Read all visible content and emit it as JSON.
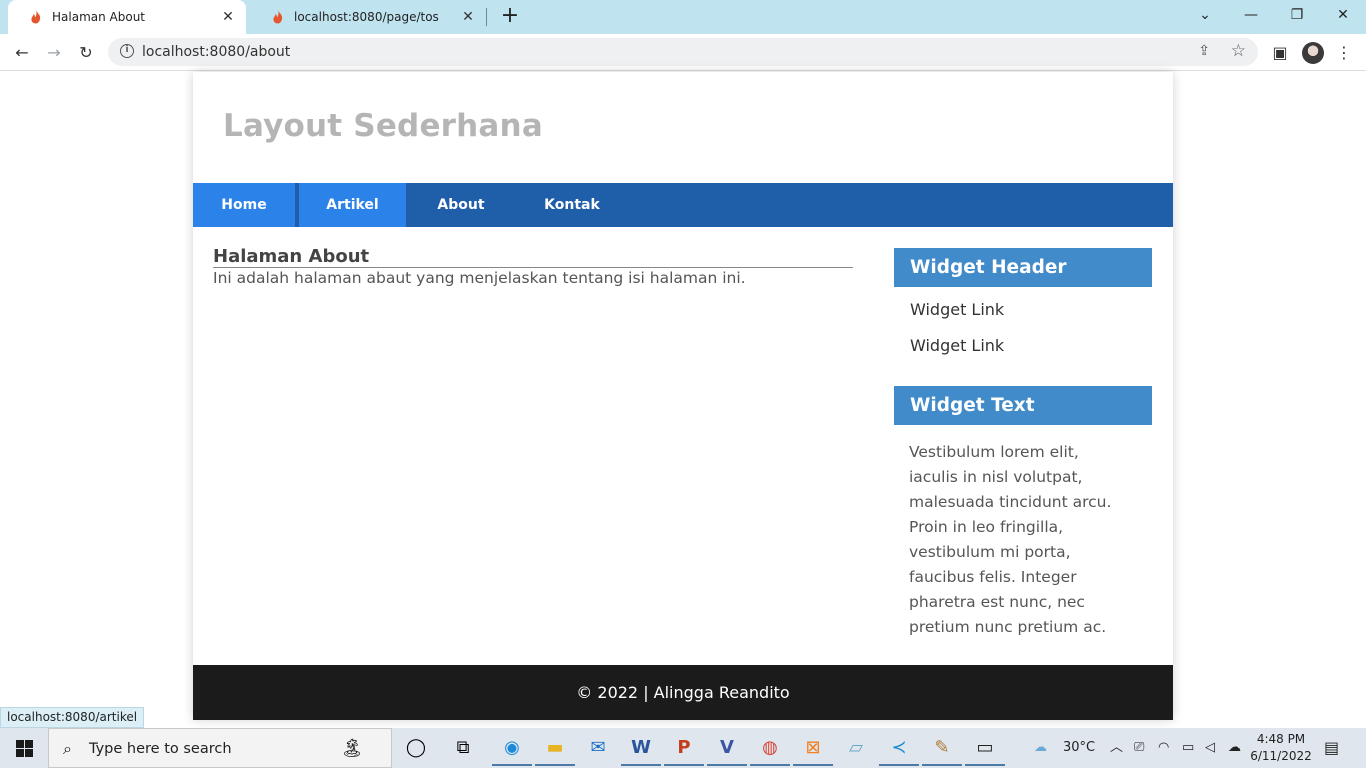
{
  "browser": {
    "tabs": [
      {
        "title": "Halaman About",
        "active": true
      },
      {
        "title": "localhost:8080/page/tos",
        "active": false
      }
    ],
    "url": "localhost:8080/about",
    "status_url": "localhost:8080/artikel"
  },
  "page": {
    "site_title": "Layout Sederhana",
    "nav": [
      "Home",
      "Artikel",
      "About",
      "Kontak"
    ],
    "article": {
      "heading": "Halaman About",
      "body": "Ini adalah halaman abaut yang menjelaskan tentang isi halaman ini."
    },
    "sidebar": {
      "widget_header_title": "Widget Header",
      "links": [
        "Widget Link",
        "Widget Link"
      ],
      "widget_text_title": "Widget Text",
      "widget_text_body": "Vestibulum lorem elit, iaculis in nisl volutpat, malesuada tincidunt arcu. Proin in leo fringilla, vestibulum mi porta, faucibus felis. Integer pharetra est nunc, nec pretium nunc pretium ac."
    },
    "footer": "© 2022 | Alingga Reandito"
  },
  "taskbar": {
    "search_placeholder": "Type here to search",
    "temperature": "30°C",
    "time": "4:48 PM",
    "date": "6/11/2022",
    "apps": [
      "task-view-icon",
      "edge-icon",
      "file-explorer-icon",
      "mail-icon",
      "word-icon",
      "powerpoint-icon",
      "visio-icon",
      "chrome-icon",
      "xampp-icon",
      "notepad-icon",
      "vscode-icon",
      "paint-icon",
      "terminal-icon"
    ]
  },
  "colors": {
    "tabstrip": "#bfe4f0",
    "navbar": "#1f5faa",
    "nav_active": "#2b83ea",
    "widget_header": "#428bca",
    "footer": "#1b1b1b",
    "site_title": "#b5b5b5"
  }
}
